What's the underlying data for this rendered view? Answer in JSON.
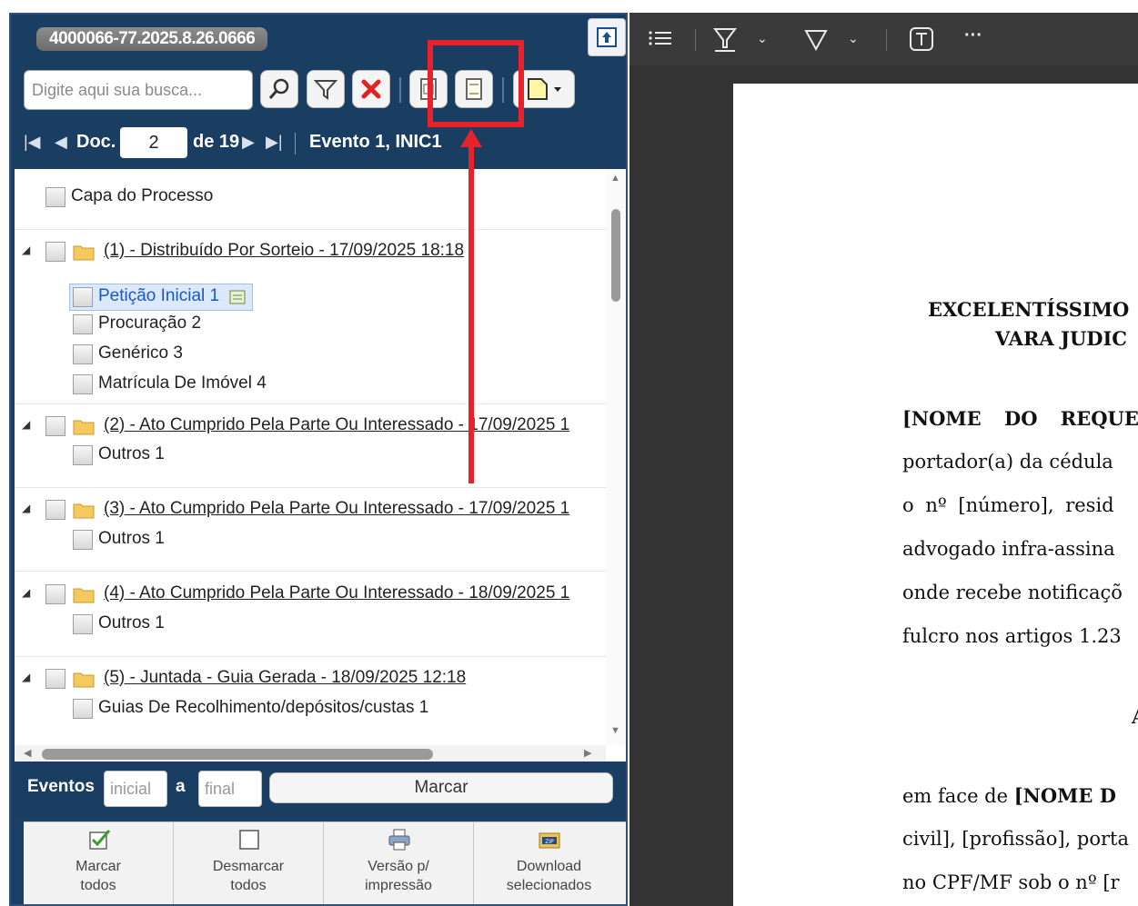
{
  "process_number": "4000066-77.2025.8.26.0666",
  "search": {
    "placeholder": "Digite aqui sua busca..."
  },
  "toolbar_icons": [
    "search-icon",
    "filter-icon",
    "clear-icon",
    "document-view-icon",
    "page-icon",
    "new-document-icon"
  ],
  "nav": {
    "doc_label": "Doc.",
    "doc_number": "2",
    "doc_total": "de 19",
    "event": "Evento 1, INIC1"
  },
  "tree": {
    "cover": "Capa do Processo",
    "events": [
      {
        "title": "(1) - Distribuído Por Sorteio - 17/09/2025 18:18",
        "docs": [
          "Petição Inicial 1",
          "Procuração 2",
          "Genérico 3",
          "Matrícula De Imóvel 4"
        ]
      },
      {
        "title": "(2) - Ato Cumprido Pela Parte Ou Interessado - 17/09/2025 1",
        "docs": [
          "Outros 1"
        ]
      },
      {
        "title": "(3) - Ato Cumprido Pela Parte Ou Interessado - 17/09/2025 1",
        "docs": [
          "Outros 1"
        ]
      },
      {
        "title": "(4) - Ato Cumprido Pela Parte Ou Interessado - 18/09/2025 1",
        "docs": [
          "Outros 1"
        ]
      },
      {
        "title": "(5) - Juntada - Guia Gerada - 18/09/2025 12:18",
        "docs": [
          "Guias De Recolhimento/depósitos/custas 1"
        ]
      }
    ]
  },
  "events_filter": {
    "label": "Eventos",
    "start_placeholder": "inicial",
    "separator": "a",
    "end_placeholder": "final",
    "mark_button": "Marcar"
  },
  "actions": [
    {
      "label": "Marcar\ntodos",
      "icon": "check-all-icon"
    },
    {
      "label": "Desmarcar\ntodos",
      "icon": "uncheck-all-icon"
    },
    {
      "label": "Versão p/\nimpressão",
      "icon": "printer-icon"
    },
    {
      "label": "Download\nselecionados",
      "icon": "zip-download-icon"
    }
  ],
  "viewer_toolbar_icons": [
    "list-icon",
    "highlight-icon",
    "chevron-down-icon",
    "draw-icon",
    "chevron-down-icon",
    "text-box-icon",
    "more-icon"
  ],
  "viewer_more": "···",
  "document": {
    "heading_1": "EXCELENTÍSSIMO",
    "heading_2": "VARA JUDIC",
    "lines": [
      "portador(a) da cédula",
      "o nº [número], resid",
      "advogado infra-assina",
      "onde recebe notificaçõ",
      "fulcro nos artigos 1.23"
    ],
    "name_line": "[NOME DO REQUE",
    "section_letter": "A",
    "face_prefix": "em face de ",
    "face_bold": "[NOME D",
    "line_civil": "civil], [profissão], porta",
    "line_cpf": "no CPF/MF sob o nº [r"
  },
  "colors": {
    "panel_bg": "#1a3d62",
    "highlight": "#e8222a",
    "viewer_bg": "#333333"
  }
}
